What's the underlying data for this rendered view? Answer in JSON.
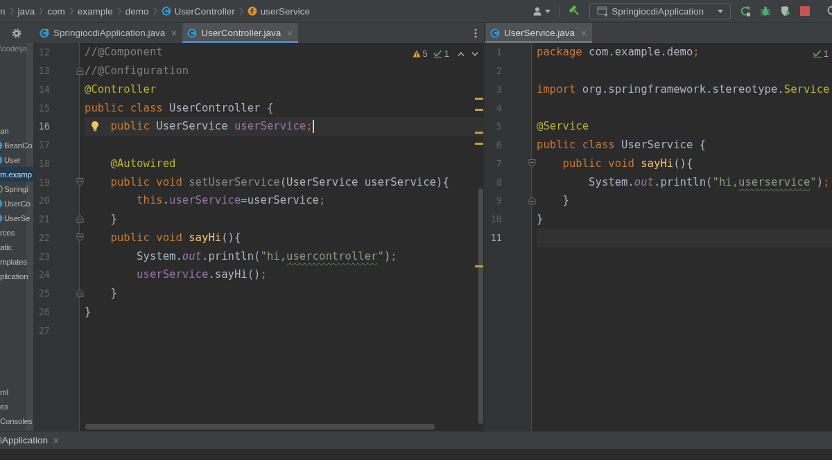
{
  "breadcrumbs": [
    {
      "label": "n",
      "kind": "folder"
    },
    {
      "label": "java",
      "kind": "folder"
    },
    {
      "label": "com",
      "kind": "folder"
    },
    {
      "label": "example",
      "kind": "folder"
    },
    {
      "label": "demo",
      "kind": "folder"
    },
    {
      "label": "UserController",
      "kind": "class"
    },
    {
      "label": "userService",
      "kind": "field"
    }
  ],
  "toolbar": {
    "run_configuration": "SpringiocdiApplication"
  },
  "project_panel": {
    "path": "\\code\\ja",
    "items": [
      {
        "label": "an",
        "kind": "plain",
        "selected": false
      },
      {
        "label": "BeanCo",
        "kind": "class",
        "selected": false
      },
      {
        "label": "User",
        "kind": "class",
        "selected": false
      },
      {
        "label": "m.examp",
        "kind": "plain",
        "selected": true
      },
      {
        "label": "Springi",
        "kind": "spring",
        "selected": false
      },
      {
        "label": "UserCo",
        "kind": "class",
        "selected": false
      },
      {
        "label": "UserSe",
        "kind": "class",
        "selected": false
      },
      {
        "label": "rces",
        "kind": "plain",
        "selected": false
      },
      {
        "label": "atic",
        "kind": "plain",
        "selected": false
      },
      {
        "label": "mplates",
        "kind": "plain",
        "selected": false
      },
      {
        "label": "plication",
        "kind": "plain",
        "selected": false
      }
    ],
    "bottom_items": [
      {
        "label": "ml",
        "selected": false
      },
      {
        "label": "es",
        "selected": false
      },
      {
        "label": "Consoles",
        "selected": false
      }
    ]
  },
  "editors": [
    {
      "focused": true,
      "options_menu": true,
      "navigation_arrows": true,
      "tabs": [
        {
          "label": "SpringiocdiApplication.java",
          "kind": "runnable",
          "selected": false
        },
        {
          "label": "UserController.java",
          "kind": "class",
          "selected": true
        }
      ],
      "inspections": [
        {
          "kind": "warning",
          "count": "5"
        },
        {
          "kind": "typo",
          "count": "1"
        }
      ],
      "lines": [
        {
          "number": "12",
          "selected": false,
          "tokens": [
            {
              "text": "//@Component",
              "kind": "comment"
            }
          ]
        },
        {
          "number": "13",
          "selected": false,
          "icons": [
            {
              "kind": "fold_end"
            }
          ],
          "tokens": [
            {
              "text": "//@Configuration",
              "kind": "comment"
            }
          ]
        },
        {
          "number": "14",
          "selected": false,
          "tokens": [
            {
              "text": "@Controller",
              "kind": "annotation"
            }
          ]
        },
        {
          "number": "15",
          "selected": false,
          "tokens": [
            {
              "text": "public class ",
              "kind": "keyword"
            },
            {
              "text": "UserController {",
              "kind": "plain"
            }
          ]
        },
        {
          "number": "16",
          "selected": true,
          "icons": [
            {
              "kind": "bulb"
            }
          ],
          "tokens": [
            {
              "text": "    public ",
              "kind": "keyword"
            },
            {
              "text": "UserService ",
              "kind": "plain"
            },
            {
              "text": "userService",
              "kind": "field"
            },
            {
              "text": ";",
              "kind": "punct"
            }
          ]
        },
        {
          "number": "17",
          "selected": false
        },
        {
          "number": "18",
          "selected": false,
          "tokens": [
            {
              "text": "    @Autowired",
              "kind": "annotation"
            }
          ]
        },
        {
          "number": "19",
          "selected": false,
          "icons": [
            {
              "kind": "fold_start"
            }
          ],
          "tokens": [
            {
              "text": "    public void ",
              "kind": "keyword"
            },
            {
              "text": "setUserService",
              "kind": "unused"
            },
            {
              "text": "(UserService userService){",
              "kind": "plain"
            }
          ]
        },
        {
          "number": "20",
          "selected": false,
          "tokens": [
            {
              "text": "        this",
              "kind": "keyword"
            },
            {
              "text": ".",
              "kind": "plain"
            },
            {
              "text": "userService",
              "kind": "field"
            },
            {
              "text": "=userService",
              "kind": "plain"
            },
            {
              "text": ";",
              "kind": "punct"
            }
          ]
        },
        {
          "number": "21",
          "selected": false,
          "icons": [
            {
              "kind": "fold_end"
            }
          ],
          "tokens": [
            {
              "text": "    }",
              "kind": "plain"
            }
          ]
        },
        {
          "number": "22",
          "selected": false,
          "icons": [
            {
              "kind": "fold_start"
            }
          ],
          "tokens": [
            {
              "text": "    public void ",
              "kind": "keyword"
            },
            {
              "text": "sayHi",
              "kind": "method"
            },
            {
              "text": "(){",
              "kind": "plain"
            }
          ]
        },
        {
          "number": "23",
          "selected": false,
          "tokens": [
            {
              "text": "        System.",
              "kind": "plain"
            },
            {
              "text": "out",
              "kind": "static"
            },
            {
              "text": ".println(",
              "kind": "plain"
            },
            {
              "text": "\"hi,",
              "kind": "string"
            },
            {
              "text": "usercontroller",
              "kind": "typo"
            },
            {
              "text": "\"",
              "kind": "string"
            },
            {
              "text": ")",
              "kind": "plain"
            },
            {
              "text": ";",
              "kind": "punct"
            }
          ]
        },
        {
          "number": "24",
          "selected": false,
          "tokens": [
            {
              "text": "        userService",
              "kind": "field"
            },
            {
              "text": ".sayHi()",
              "kind": "plain"
            },
            {
              "text": ";",
              "kind": "punct"
            }
          ]
        },
        {
          "number": "25",
          "selected": false,
          "icons": [
            {
              "kind": "fold_end"
            }
          ],
          "tokens": [
            {
              "text": "    }",
              "kind": "plain"
            }
          ]
        },
        {
          "number": "26",
          "selected": false,
          "tokens": [
            {
              "text": "}",
              "kind": "plain"
            }
          ]
        },
        {
          "number": "27",
          "selected": false
        }
      ]
    },
    {
      "focused": false,
      "options_menu": false,
      "navigation_arrows": false,
      "tabs": [
        {
          "label": "UserService.java",
          "kind": "class",
          "selected": true
        }
      ],
      "inspections": [
        {
          "kind": "typo",
          "count": "1"
        }
      ],
      "lines": [
        {
          "number": "1",
          "selected": false,
          "tokens": [
            {
              "text": "package ",
              "kind": "keyword"
            },
            {
              "text": "com.example.demo",
              "kind": "plain"
            },
            {
              "text": ";",
              "kind": "punct"
            }
          ]
        },
        {
          "number": "2",
          "selected": false
        },
        {
          "number": "3",
          "selected": false,
          "tokens": [
            {
              "text": "import ",
              "kind": "keyword"
            },
            {
              "text": "org.springframework.stereotype.",
              "kind": "plain"
            },
            {
              "text": "Service",
              "kind": "annotation"
            }
          ]
        },
        {
          "number": "4",
          "selected": false
        },
        {
          "number": "5",
          "selected": false,
          "tokens": [
            {
              "text": "@Service",
              "kind": "annotation"
            }
          ]
        },
        {
          "number": "6",
          "selected": false,
          "tokens": [
            {
              "text": "public class ",
              "kind": "keyword"
            },
            {
              "text": "UserService {",
              "kind": "plain"
            }
          ]
        },
        {
          "number": "7",
          "selected": false,
          "icons": [
            {
              "kind": "fold_start"
            }
          ],
          "tokens": [
            {
              "text": "    public void ",
              "kind": "keyword"
            },
            {
              "text": "sayHi",
              "kind": "method"
            },
            {
              "text": "(){",
              "kind": "plain"
            }
          ]
        },
        {
          "number": "8",
          "selected": false,
          "tokens": [
            {
              "text": "        System.",
              "kind": "plain"
            },
            {
              "text": "out",
              "kind": "static"
            },
            {
              "text": ".println(",
              "kind": "plain"
            },
            {
              "text": "\"hi,",
              "kind": "string"
            },
            {
              "text": "userservice",
              "kind": "typo"
            },
            {
              "text": "\"",
              "kind": "string"
            },
            {
              "text": ")",
              "kind": "plain"
            },
            {
              "text": ";",
              "kind": "punct"
            }
          ]
        },
        {
          "number": "9",
          "selected": false,
          "icons": [
            {
              "kind": "fold_end"
            }
          ],
          "tokens": [
            {
              "text": "    }",
              "kind": "plain"
            }
          ]
        },
        {
          "number": "10",
          "selected": false,
          "tokens": [
            {
              "text": "}",
              "kind": "plain"
            }
          ]
        },
        {
          "number": "11",
          "selected": true
        }
      ]
    }
  ],
  "tool_window_tabs": [
    {
      "label": "iApplication"
    }
  ]
}
